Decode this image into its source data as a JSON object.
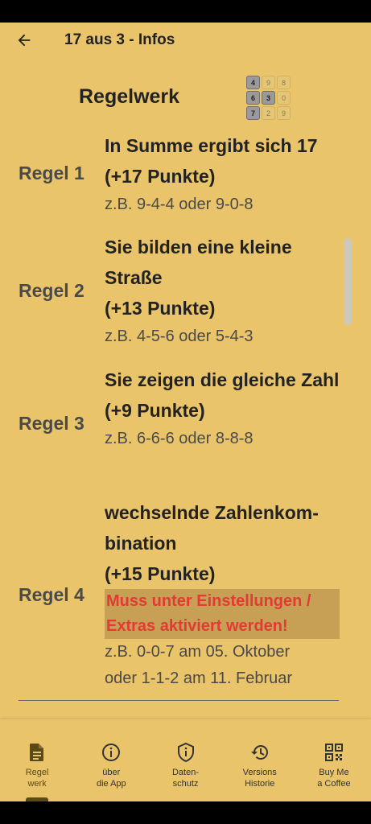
{
  "app_bar": {
    "title": "17 aus 3 - Infos"
  },
  "heading": "Regelwerk",
  "logo": {
    "tiles": [
      {
        "n": "4",
        "on": true
      },
      {
        "n": "9",
        "on": false
      },
      {
        "n": "8",
        "on": false
      },
      {
        "n": "6",
        "on": true
      },
      {
        "n": "3",
        "on": true
      },
      {
        "n": "0",
        "on": false
      },
      {
        "n": "7",
        "on": true
      },
      {
        "n": "2",
        "on": false
      },
      {
        "n": "9",
        "on": false
      }
    ]
  },
  "rules": [
    {
      "label": "Regel 1",
      "title": "In Summe ergibt sich 17",
      "points": "(+17 Punkte)",
      "examples": [
        "z.B. 9-4-4 oder 9-0-8"
      ]
    },
    {
      "label": "Regel 2",
      "title": "Sie bilden eine kleine Straße",
      "points": "(+13 Punkte)",
      "examples": [
        "z.B. 4-5-6 oder 5-4-3"
      ]
    },
    {
      "label": "Regel 3",
      "title": "Sie zeigen die gleiche Zahl",
      "points": "(+9 Punkte)",
      "examples": [
        "z.B. 6-6-6 oder 8-8-8"
      ]
    },
    {
      "label": "Regel 4",
      "title": "wechselnde Zahlenkombination",
      "title_lines": [
        "wechselnde Zahlenkom-",
        "bination"
      ],
      "points": "(+15 Punkte)",
      "warning": "Muss unter Einstellungen / Extras aktiviert werden!",
      "examples": [
        "z.B. 0-0-7 am 05. Oktober",
        "oder 1-1-2 am 11. Februar"
      ]
    }
  ],
  "nav": [
    {
      "label": "Regel\nwerk",
      "icon": "document-icon",
      "active": true
    },
    {
      "label": "über\ndie App",
      "icon": "info-icon",
      "active": false
    },
    {
      "label": "Daten-\nschutz",
      "icon": "shield-icon",
      "active": false
    },
    {
      "label": "Versions\nHistorie",
      "icon": "history-icon",
      "active": false
    },
    {
      "label": "Buy Me\na Coffee",
      "icon": "qr-code-icon",
      "active": false
    }
  ]
}
